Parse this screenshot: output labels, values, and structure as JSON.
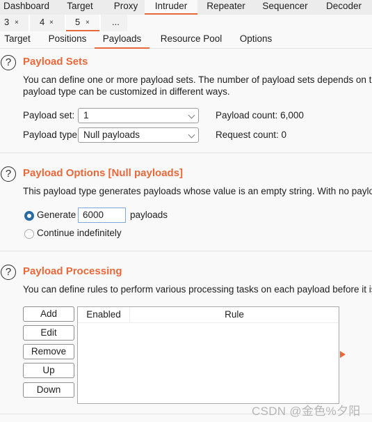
{
  "main_tabs": [
    {
      "label": "Dashboard",
      "active": false
    },
    {
      "label": "Target",
      "active": false
    },
    {
      "label": "Proxy",
      "active": false
    },
    {
      "label": "Intruder",
      "active": true
    },
    {
      "label": "Repeater",
      "active": false
    },
    {
      "label": "Sequencer",
      "active": false
    },
    {
      "label": "Decoder",
      "active": false
    }
  ],
  "attack_tabs": [
    {
      "number": "3",
      "close": "×",
      "active": false
    },
    {
      "number": "4",
      "close": "×",
      "active": false
    },
    {
      "number": "5",
      "close": "×",
      "active": true
    },
    {
      "number": "...",
      "close": "",
      "active": false
    }
  ],
  "intruder_tabs": [
    {
      "label": "Target",
      "active": false
    },
    {
      "label": "Positions",
      "active": false
    },
    {
      "label": "Payloads",
      "active": true
    },
    {
      "label": "Resource Pool",
      "active": false
    },
    {
      "label": "Options",
      "active": false
    }
  ],
  "payload_sets": {
    "help_icon": "?",
    "title": "Payload Sets",
    "description_line1": "You can define one or more payload sets. The number of payload sets depends on the a",
    "description_line2": "payload type can be customized in different ways.",
    "payload_set_label": "Payload set:",
    "payload_set_value": "1",
    "payload_type_label": "Payload type:",
    "payload_type_value": "Null payloads",
    "payload_count": "Payload count: 6,000",
    "request_count": "Request count: 0"
  },
  "payload_options": {
    "help_icon": "?",
    "title": "Payload Options [Null payloads]",
    "description": "This payload type generates payloads whose value is an empty string. With no payload m",
    "generate_label": "Generate",
    "generate_value": "6000",
    "generate_suffix": "payloads",
    "generate_selected": true,
    "continue_label": "Continue indefinitely",
    "continue_selected": false
  },
  "payload_processing": {
    "help_icon": "?",
    "title": "Payload Processing",
    "description": "You can define rules to perform various processing tasks on each payload before it is us",
    "buttons": {
      "add": "Add",
      "edit": "Edit",
      "remove": "Remove",
      "up": "Up",
      "down": "Down"
    },
    "table_headers": {
      "enabled": "Enabled",
      "rule": "Rule"
    },
    "rows": []
  },
  "watermark": "CSDN @金色%夕阳",
  "colors": {
    "accent": "#e8683a",
    "radio_selected": "#2a6ba3"
  }
}
